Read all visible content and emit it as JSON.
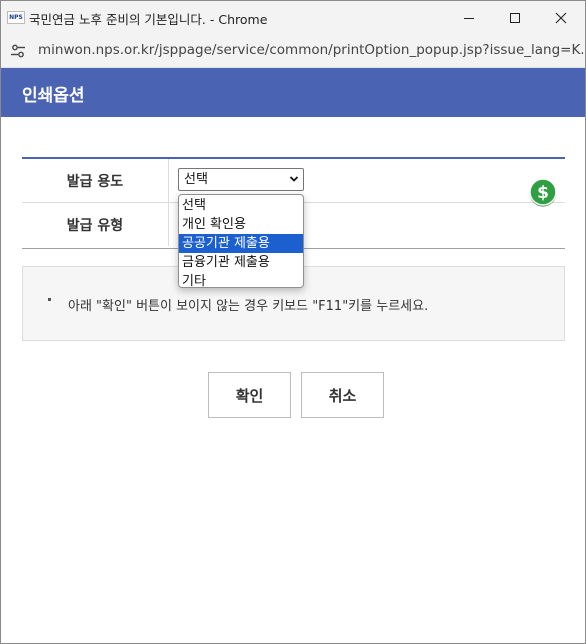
{
  "window": {
    "favicon_text": "NPS",
    "title": "국민연금 노후 준비의 기본입니다. - Chrome",
    "url": "minwon.nps.or.kr/jsppage/service/common/printOption_popup.jsp?issue_lang=K..."
  },
  "header": {
    "title": "인쇄옵션"
  },
  "form": {
    "purpose_label": "발급 용도",
    "purpose_value": "선택",
    "type_label": "발급 유형",
    "purpose_options": [
      "선택",
      "개인 확인용",
      "공공기관 제출용",
      "금융기관 제출용",
      "기타"
    ],
    "highlighted_option": "공공기관 제출용"
  },
  "notice": {
    "text": "아래 \"확인\" 버튼이 보이지 않는 경우 키보드 \"F11\"키를 누르세요."
  },
  "buttons": {
    "ok": "확인",
    "cancel": "취소"
  },
  "colors": {
    "header_bg": "#4a63b2",
    "highlight": "#1c60d0",
    "dollar_badge": "#2ea043"
  },
  "icons": [
    "minimize-icon",
    "maximize-icon",
    "close-icon",
    "site-settings-icon",
    "chevron-down-icon",
    "dollar-icon"
  ]
}
